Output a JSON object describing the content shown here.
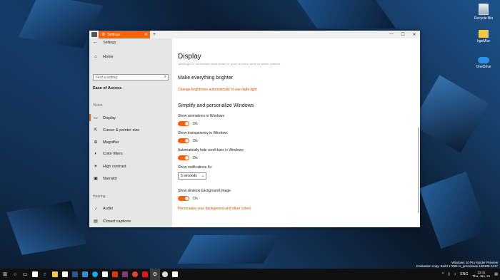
{
  "desktop": {
    "icons": [
      {
        "label": "Recycle Bin",
        "icon": "recycle-bin-icon"
      },
      {
        "label": "hgeMlur",
        "icon": "folder-icon"
      },
      {
        "label": "OneDrive",
        "icon": "onedrive-icon"
      }
    ],
    "watermark": {
      "line1": "Windows 10 Pro Insider Preview",
      "line2": "Evaluation copy. Build 17083.rs_prerelease.180109-1317"
    }
  },
  "window": {
    "tab_title": "Settings",
    "new_tab": "+",
    "controls": {
      "minimize": "—",
      "maximize": "☐",
      "close": "✕"
    }
  },
  "sidebar": {
    "back_label": "Settings",
    "home": "Home",
    "search_placeholder": "Find a setting",
    "heading": "Ease of Access",
    "vision_group": "Vision",
    "vision_items": [
      {
        "label": "Display",
        "icon": "display-icon"
      },
      {
        "label": "Cursor & pointer size",
        "icon": "cursor-icon"
      },
      {
        "label": "Magnifier",
        "icon": "magnifier-icon"
      },
      {
        "label": "Color filters",
        "icon": "color-filters-icon"
      },
      {
        "label": "High contrast",
        "icon": "high-contrast-icon"
      },
      {
        "label": "Narrator",
        "icon": "narrator-icon"
      }
    ],
    "hearing_group": "Hearing",
    "hearing_items": [
      {
        "label": "Audio",
        "icon": "audio-icon"
      },
      {
        "label": "Closed captions",
        "icon": "closed-captions-icon"
      }
    ]
  },
  "content": {
    "title": "Display",
    "clipped_text": "Settings in Windows and what of your screen and in other places",
    "section1": "Make everything brighter",
    "link1": "Change brightness automatically or use night light",
    "section2": "Simplify and personalize Windows",
    "toggles": [
      {
        "label": "Show animations in Windows",
        "state": "On"
      },
      {
        "label": "Show transparency in Windows",
        "state": "On"
      },
      {
        "label": "Automatically hide scroll bars in Windows",
        "state": "On"
      }
    ],
    "notifications_label": "Show notifications for",
    "notifications_value": "5 seconds",
    "bg_label": "Show desktop background image",
    "bg_state": "On",
    "link2": "Personalize your background and other colors"
  },
  "taskbar": {
    "language": "ENG",
    "time": "13:41",
    "date": "Thu, Jan. 21"
  },
  "colors": {
    "accent": "#f7630c",
    "sidebar": "#e6e6e6",
    "taskbar": "#101010"
  }
}
